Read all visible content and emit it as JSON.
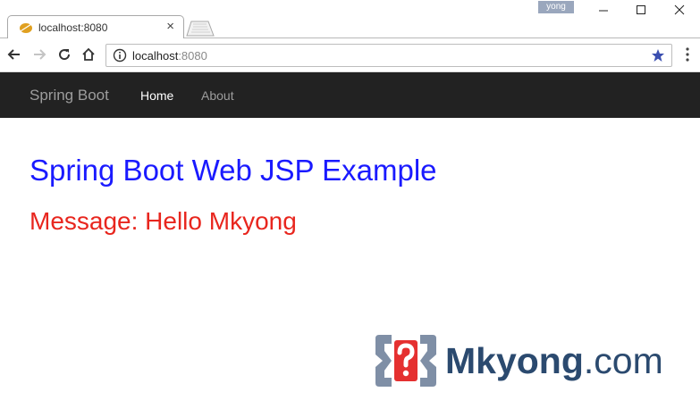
{
  "browser": {
    "tab": {
      "title": "localhost:8080",
      "close_glyph": "×"
    },
    "profile": "yong",
    "window_controls": [
      "minimize",
      "maximize",
      "close"
    ],
    "address_bar": {
      "host": "localhost",
      "port": ":8080"
    },
    "icons": {
      "favicon": "spring-leaf-icon",
      "back": "back-arrow-icon",
      "forward": "forward-arrow-icon",
      "reload": "reload-icon",
      "home": "home-icon",
      "info": "info-icon",
      "bookmark": "star-icon",
      "menu": "kebab-menu-icon"
    }
  },
  "navbar": {
    "brand": "Spring Boot",
    "links": [
      {
        "label": "Home",
        "active": true
      },
      {
        "label": "About",
        "active": false
      }
    ],
    "background": "#222222"
  },
  "content": {
    "heading": "Spring Boot Web JSP Example",
    "message": "Message: Hello Mkyong",
    "heading_color": "#1a1aff",
    "message_color": "#e8261e"
  },
  "watermark": {
    "name": "Mkyong",
    "domain": ".com"
  }
}
